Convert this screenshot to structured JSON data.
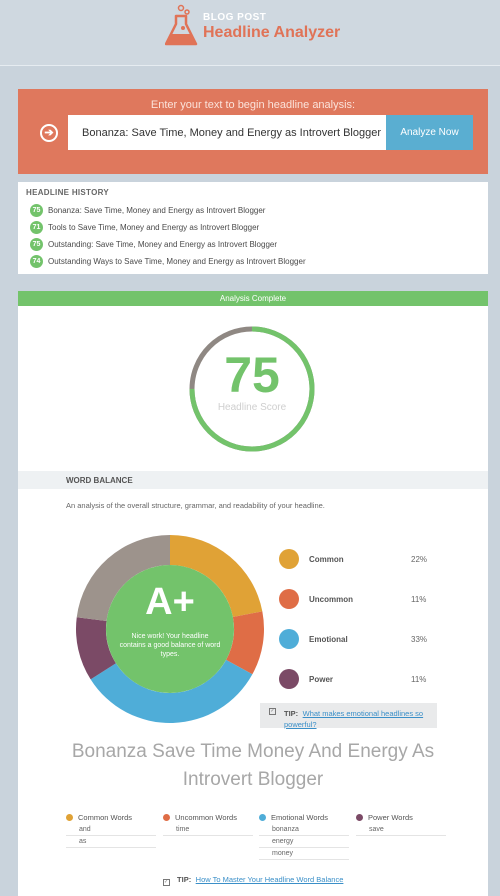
{
  "header": {
    "brand_small": "BLOG POST",
    "brand_big": "Headline Analyzer",
    "logo_icon": "flask-icon"
  },
  "input": {
    "prompt": "Enter your text to begin headline analysis:",
    "value": "Bonanza: Save Time, Money and Energy as Introvert Blogger",
    "button_label": "Analyze Now",
    "arrow_icon": "arrow-right-circle-icon"
  },
  "history": {
    "title": "HEADLINE HISTORY",
    "items": [
      {
        "score": "75",
        "text": "Bonanza: Save Time, Money and Energy as Introvert Blogger"
      },
      {
        "score": "71",
        "text": "Tools to Save Time, Money and Energy as Introvert Blogger"
      },
      {
        "score": "75",
        "text": "Outstanding: Save Time, Money and Energy as Introvert Blogger"
      },
      {
        "score": "74",
        "text": "Outstanding Ways to Save Time, Money and Energy as Introvert Blogger"
      }
    ]
  },
  "analysis": {
    "status": "Analysis Complete",
    "score": 75,
    "score_text": "75",
    "score_label": "Headline Score"
  },
  "word_balance": {
    "title": "WORD BALANCE",
    "description": "An analysis of the overall structure, grammar, and readability of your headline.",
    "grade": "A+",
    "grade_message": "Nice work! Your headline contains a good balance of word types.",
    "categories": [
      {
        "name": "Common",
        "percent": 22,
        "percent_text": "22%",
        "color": "#e0a236"
      },
      {
        "name": "Uncommon",
        "percent": 11,
        "percent_text": "11%",
        "color": "#df6d46"
      },
      {
        "name": "Emotional",
        "percent": 33,
        "percent_text": "33%",
        "color": "#4fadd8"
      },
      {
        "name": "Power",
        "percent": 11,
        "percent_text": "11%",
        "color": "#7b4a66"
      }
    ],
    "remainder_color": "#9d938c",
    "inner_color": "#73c36b",
    "tip1": {
      "label": "TIP:",
      "link": "What makes emotional headlines so powerful?"
    },
    "headline_display": "Bonanza Save Time Money And Energy As Introvert Blogger",
    "word_lists": [
      {
        "title": "Common Words",
        "color": "#e0a236",
        "words": [
          "and",
          "as"
        ]
      },
      {
        "title": "Uncommon Words",
        "color": "#df6d46",
        "words": [
          "time"
        ]
      },
      {
        "title": "Emotional Words",
        "color": "#4fadd8",
        "words": [
          "bonanza",
          "energy",
          "money"
        ]
      },
      {
        "title": "Power Words",
        "color": "#7b4a66",
        "words": [
          "save"
        ]
      }
    ],
    "tip2": {
      "label": "TIP:",
      "link": "How To Master Your Headline Word Balance"
    }
  },
  "colors": {
    "accent_orange": "#df785d",
    "accent_green": "#73c36b",
    "button_blue": "#5aaed1"
  }
}
